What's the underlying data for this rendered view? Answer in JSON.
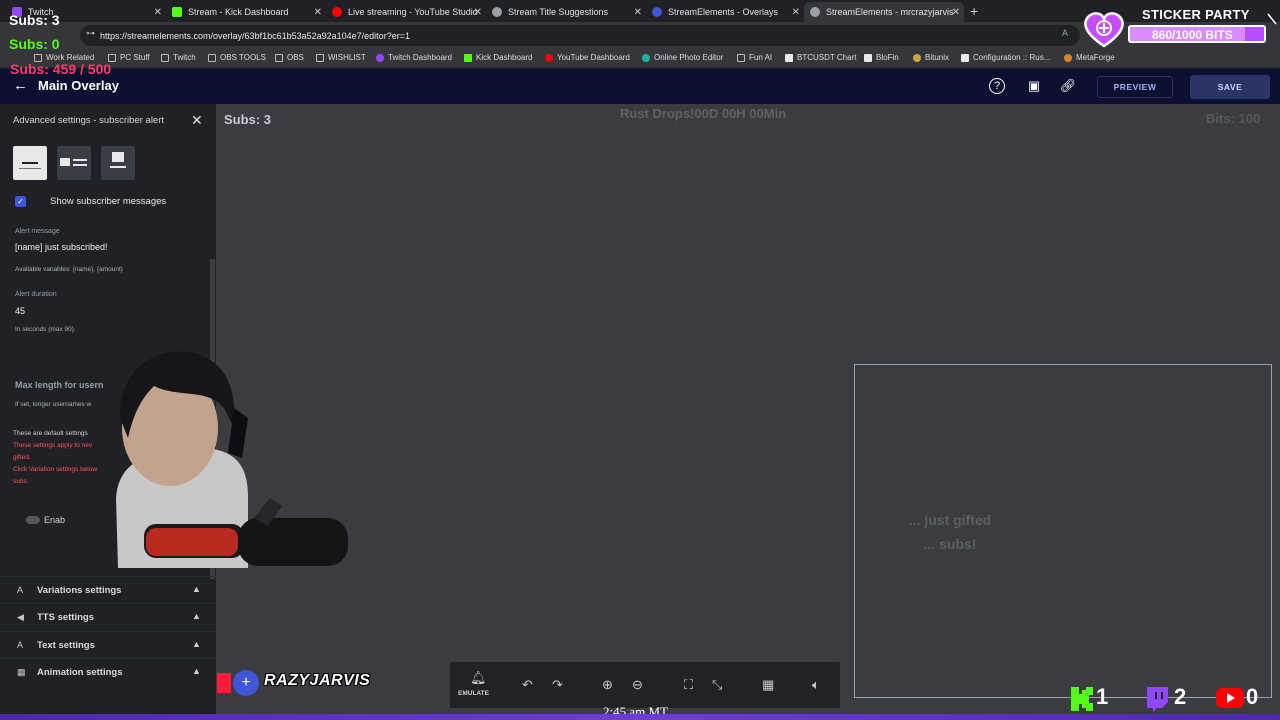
{
  "browser": {
    "tabs": [
      {
        "label": "Twitch",
        "color": "#9146ff"
      },
      {
        "label": "Stream - Kick Dashboard",
        "color": "#53fc18"
      },
      {
        "label": "Live streaming - YouTube Studio",
        "color": "#ff0000"
      },
      {
        "label": "Stream Title Suggestions",
        "color": "#9aa0a6"
      },
      {
        "label": "StreamElements - Overlays",
        "color": "#3e56d8"
      },
      {
        "label": "StreamElements - mrcrazyjarvis",
        "color": "#9aa0a6"
      }
    ],
    "url": "https://streamelements.com/overlay/63bf1bc61b53a52a92a104e7/editor?er=1",
    "bookmarks": [
      "Work Related",
      "PC Stuff",
      "Twitch",
      "OBS TOOLS",
      "OBS",
      "WISHLIST",
      "Twitch Dashboard",
      "Kick Dashboard",
      "YouTube Dashboard",
      "Online Photo Editor",
      "Fun AI",
      "BTCUSDT Chart",
      "BloFin",
      "Bitunix",
      "Configuration :: Rus...",
      "MetaForge"
    ]
  },
  "header": {
    "title": "Main Overlay",
    "preview_label": "PREVIEW",
    "save_label": "SAVE"
  },
  "sidebar": {
    "title": "Advanced settings - subscriber alert",
    "show_messages_label": "Show subscriber messages",
    "alert_message_label": "Alert message",
    "alert_message_value": "[name] just subscribed!",
    "variables_hint": "Available variables: {name}, {amount}",
    "alert_duration_label": "Alert duration",
    "alert_duration_value": "45",
    "duration_hint": "In seconds (max 90).",
    "max_length_label": "Max length for usern",
    "max_length_hint": "If set, longer usernames w",
    "default_note": "These are default settings",
    "warn_1": "These settings apply to nev",
    "warn_2": "gifted.",
    "warn_3": "Click Variation settings below",
    "warn_4": "subs.",
    "enable_label": "Enab",
    "accordions": [
      {
        "label": "Variations settings"
      },
      {
        "label": "TTS settings"
      },
      {
        "label": "Text settings"
      },
      {
        "label": "Animation settings"
      }
    ]
  },
  "canvas": {
    "subs_widget": "Subs: 3",
    "rust_widget": "Rust Drops!00D 00H 00Min",
    "bits_widget": "Bits: 100",
    "alert_preview_1": "... just gifted",
    "alert_preview_2": "... subs!"
  },
  "toolbar": {
    "emulate_label": "EMULATE"
  },
  "overlay": {
    "subs_white": "Subs: 3",
    "subs_green": "Subs: 0",
    "sub_goal": "Subs: 459 / 500",
    "sticker_title": "STICKER PARTY",
    "sticker_bits": "860/1000 BITS",
    "sticker_progress": 0.86,
    "name_tag": "RAZYJARVIS",
    "kick_count": "1",
    "twitch_count": "2",
    "youtube_count": "0",
    "clock": "2:45 am MT"
  }
}
